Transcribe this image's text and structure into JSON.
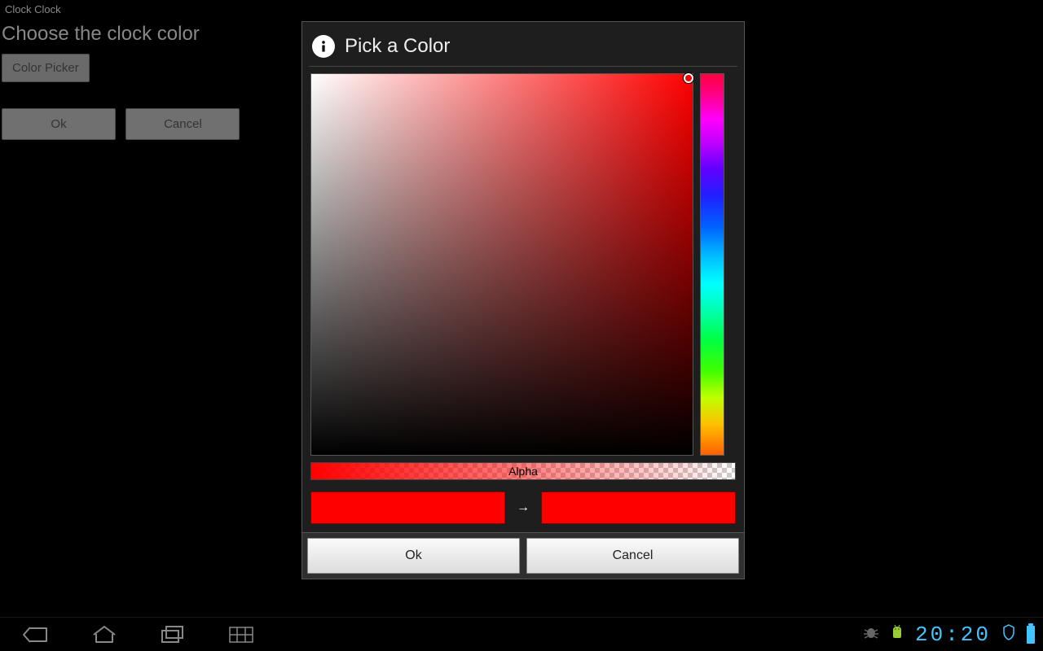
{
  "app": {
    "title": "Clock Clock",
    "heading": "Choose the clock color",
    "color_picker_btn": "Color Picker",
    "ok": "Ok",
    "cancel": "Cancel"
  },
  "dialog": {
    "title": "Pick a Color",
    "alpha_label": "Alpha",
    "ok": "Ok",
    "cancel": "Cancel",
    "old_color": "#ff0000",
    "new_color": "#ff0000"
  },
  "status": {
    "time": "20:20"
  }
}
